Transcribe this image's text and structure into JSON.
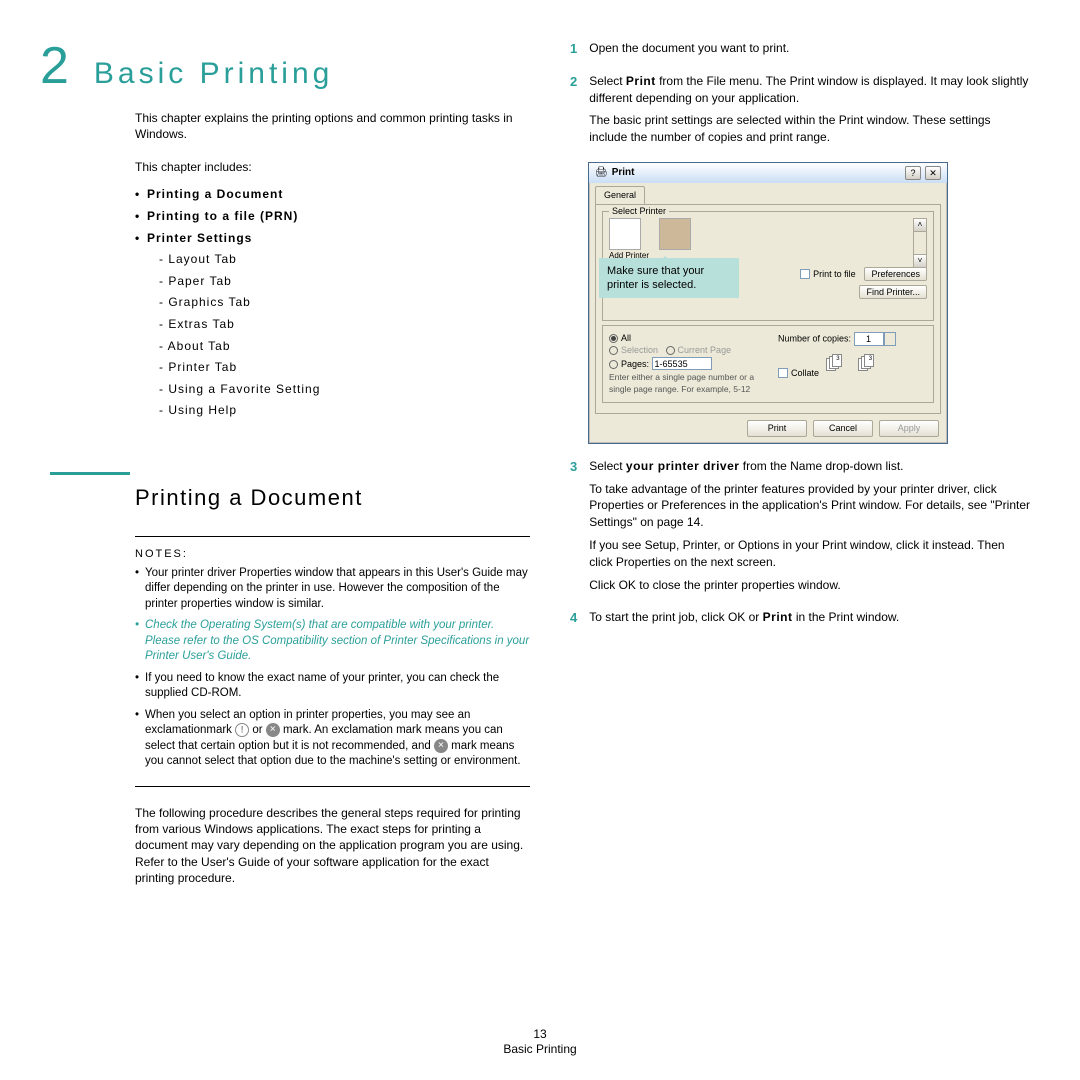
{
  "chapter": {
    "number": "2",
    "title": "Basic Printing"
  },
  "intro": "This chapter explains the printing options and common printing tasks in Windows.",
  "includes": "This chapter includes:",
  "toc": {
    "i1": "Printing a Document",
    "i2": "Printing to a file (PRN)",
    "i3": "Printer Settings",
    "s1": "- Layout Tab",
    "s2": "- Paper Tab",
    "s3": "- Graphics Tab",
    "s4": "- Extras Tab",
    "s5": "- About Tab",
    "s6": "- Printer Tab",
    "s7": "- Using a Favorite Setting",
    "s8": "- Using Help"
  },
  "section_title": "Printing a Document",
  "notes_label": "NOTES:",
  "notes": {
    "n1": "Your printer driver Properties window that appears in this User's Guide may differ depending on the printer in use. However the composition of the printer properties window is similar.",
    "n2": "Check the Operating System(s) that are compatible with your printer. Please refer to the OS Compatibility section of Printer Specifications in your Printer User's Guide.",
    "n3": "If you need to know the exact name of your printer, you can check the supplied CD-ROM.",
    "n4_a": "When you select an option in printer properties, you may see an exclamationmark ",
    "n4_b": " or ",
    "n4_c": " mark. An exclamation mark means you can select that certain option but it is not recommended, and ",
    "n4_d": " mark means you cannot select that option due to the machine's setting or environment."
  },
  "below_notes": "The following procedure describes the general steps required for printing from various Windows applications. The exact steps for printing a document may vary depending on the application program you are using. Refer to the User's Guide of your software application for the exact printing procedure.",
  "steps": {
    "s1": "Open the document you want to print.",
    "s2_a": "Select ",
    "s2_b": "Print",
    "s2_c": " from the File menu. The Print window is displayed. It may look slightly different depending on your application.",
    "s2_p2": "The basic print settings are selected within the Print window. These settings include the number of copies and print range.",
    "s3_a": "Select ",
    "s3_b": "your printer driver",
    "s3_c": " from the Name drop-down list.",
    "s3_p2": "To take advantage of the printer features provided by your printer driver, click Properties or Preferences in the application's Print window. For details, see \"Printer Settings\" on page 14.",
    "s3_p3": "If you see Setup, Printer, or Options in your Print window, click it instead. Then click Properties on the next screen.",
    "s3_p4": "Click OK to close the printer properties window.",
    "s4_a": "To start the print job, click OK or ",
    "s4_b": "Print",
    "s4_c": " in the Print window."
  },
  "dialog": {
    "title": "Print",
    "tab": "General",
    "select_printer": "Select Printer",
    "add_printer": "Add Printer",
    "print_to_file": "Print to file",
    "preferences": "Preferences",
    "find_printer": "Find Printer...",
    "callout": "Make sure that your printer is selected.",
    "all": "All",
    "selection": "Selection",
    "current_page": "Current Page",
    "pages": "Pages:",
    "pages_val": "1-65535",
    "pages_hint": "Enter either a single page number or a single page range. For example, 5-12",
    "copies_label": "Number of copies:",
    "copies_val": "1",
    "collate": "Collate",
    "print_btn": "Print",
    "cancel_btn": "Cancel",
    "apply_btn": "Apply"
  },
  "footer": {
    "pagenum": "13",
    "title": "Basic Printing"
  }
}
